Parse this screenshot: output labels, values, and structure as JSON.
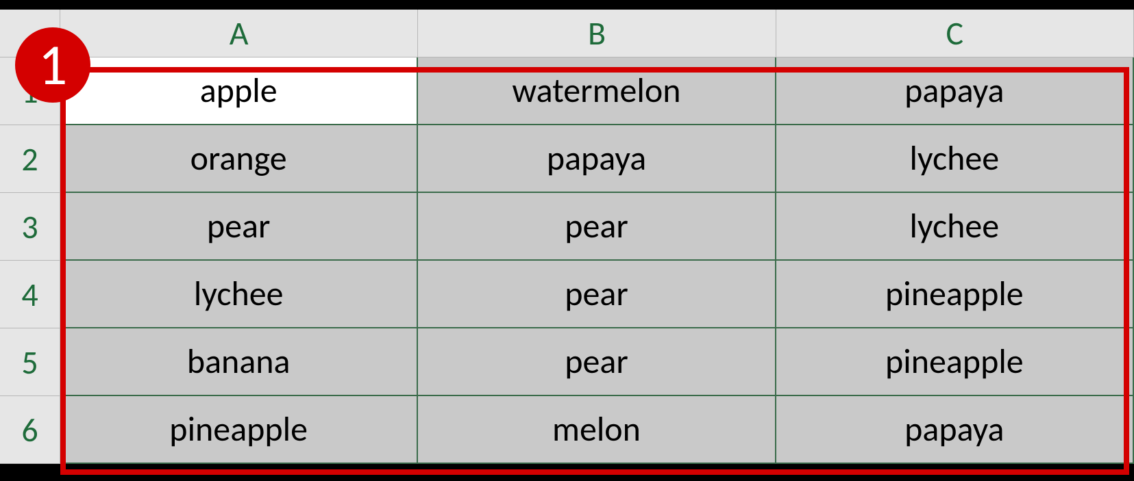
{
  "annotation": {
    "badge": "1"
  },
  "columns": [
    "A",
    "B",
    "C"
  ],
  "row_numbers": [
    "1",
    "2",
    "3",
    "4",
    "5",
    "6"
  ],
  "active_cell": "A1",
  "cells": {
    "r1": {
      "A": "apple",
      "B": "watermelon",
      "C": "papaya"
    },
    "r2": {
      "A": "orange",
      "B": "papaya",
      "C": "lychee"
    },
    "r3": {
      "A": "pear",
      "B": "pear",
      "C": "lychee"
    },
    "r4": {
      "A": "lychee",
      "B": "pear",
      "C": "pineapple"
    },
    "r5": {
      "A": "banana",
      "B": "pear",
      "C": "pineapple"
    },
    "r6": {
      "A": "pineapple",
      "B": "melon",
      "C": "papaya"
    }
  }
}
